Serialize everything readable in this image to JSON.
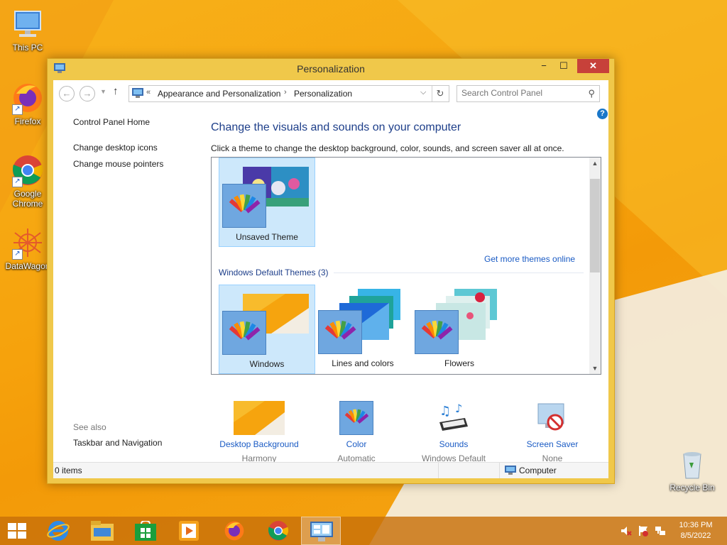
{
  "desktop": {
    "icons": [
      {
        "label": "This PC",
        "icon": "computer-icon"
      },
      {
        "label": "Firefox",
        "icon": "firefox-icon"
      },
      {
        "label": "Google Chrome",
        "icon": "chrome-icon"
      },
      {
        "label": "DataWagon",
        "icon": "datawagon-icon"
      },
      {
        "label": "Recycle Bin",
        "icon": "recycle-bin-icon"
      }
    ]
  },
  "window": {
    "title": "Personalization",
    "controls": {
      "minimize": "−",
      "maximize": "☐",
      "close": "✕"
    },
    "address": {
      "overflow": "«",
      "crumbs": [
        "Appearance and Personalization",
        "Personalization"
      ],
      "separator": "›"
    },
    "search": {
      "placeholder": "Search Control Panel"
    },
    "help": "?",
    "left_nav": {
      "items": [
        "Control Panel Home",
        "Change desktop icons",
        "Change mouse pointers"
      ],
      "see_also_label": "See also",
      "see_also_items": [
        "Taskbar and Navigation"
      ]
    },
    "main": {
      "heading": "Change the visuals and sounds on your computer",
      "subtext": "Click a theme to change the desktop background, color, sounds, and screen saver all at once.",
      "my_themes": [
        {
          "name": "Unsaved Theme",
          "selected": true
        }
      ],
      "get_more_link": "Get more themes online",
      "default_section": "Windows Default Themes (3)",
      "default_themes": [
        {
          "name": "Windows",
          "selected": true
        },
        {
          "name": "Lines and colors",
          "selected": false
        },
        {
          "name": "Flowers",
          "selected": false
        }
      ]
    },
    "bottom": [
      {
        "label": "Desktop Background",
        "value": "Harmony",
        "icon": "desktop-background-icon"
      },
      {
        "label": "Color",
        "value": "Automatic",
        "icon": "color-palette-icon"
      },
      {
        "label": "Sounds",
        "value": "Windows Default",
        "icon": "sounds-icon"
      },
      {
        "label": "Screen Saver",
        "value": "None",
        "icon": "screen-saver-icon"
      }
    ],
    "status": {
      "items": "0 items",
      "location": "Computer"
    }
  },
  "taskbar": {
    "apps": [
      "start-icon",
      "internet-explorer-icon",
      "file-explorer-icon",
      "store-icon",
      "media-icon",
      "firefox-icon",
      "chrome-icon",
      "control-panel-icon"
    ],
    "clock": {
      "time": "10:36 PM",
      "date": "8/5/2022"
    }
  },
  "colors": {
    "accent": "#f6a20c",
    "link": "#1a5bc4",
    "heading": "#1e3f8a",
    "close": "#c7413a"
  }
}
